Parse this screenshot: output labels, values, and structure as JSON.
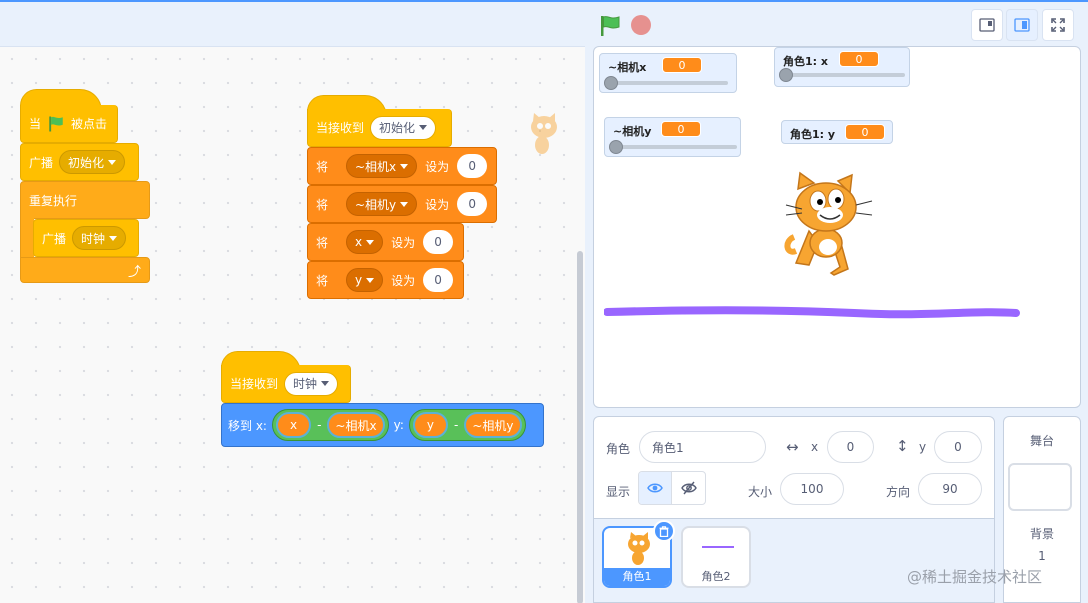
{
  "toolbar": {
    "flag_icon": "green-flag-icon",
    "stop_icon": "stop-icon"
  },
  "scripts": {
    "script1": {
      "hat_when": "当",
      "hat_clicked": "被点击",
      "broadcast": "广播",
      "broadcast_msg": "初始化",
      "forever": "重复执行",
      "broadcast2": "广播",
      "broadcast2_msg": "时钟"
    },
    "script2": {
      "hat": "当接收到",
      "hat_msg": "初始化",
      "rows": [
        {
          "set": "将",
          "var": "~相机x",
          "to": "设为",
          "value": "0"
        },
        {
          "set": "将",
          "var": "~相机y",
          "to": "设为",
          "value": "0"
        },
        {
          "set": "将",
          "var": "x",
          "to": "设为",
          "value": "0"
        },
        {
          "set": "将",
          "var": "y",
          "to": "设为",
          "value": "0"
        }
      ]
    },
    "script3": {
      "hat": "当接收到",
      "hat_msg": "时钟",
      "goto": "移到 x:",
      "x_var": "x",
      "minus": "-",
      "cam_x": "~相机x",
      "y_label": "y:",
      "y_var": "y",
      "cam_y": "~相机y"
    }
  },
  "monitors": {
    "camx": {
      "label": "~相机x",
      "value": "0"
    },
    "sprite_x": {
      "label": "角色1: x",
      "value": "0"
    },
    "camy": {
      "label": "~相机y",
      "value": "0"
    },
    "sprite_y": {
      "label": "角色1: y",
      "value": "0"
    }
  },
  "sprite_info": {
    "sprite_label": "角色",
    "sprite_name": "角色1",
    "x_label": "x",
    "x_value": "0",
    "y_label": "y",
    "y_value": "0",
    "show_label": "显示",
    "size_label": "大小",
    "size_value": "100",
    "direction_label": "方向",
    "direction_value": "90"
  },
  "sprites": [
    {
      "name": "角色1",
      "selected": true
    },
    {
      "name": "角色2",
      "selected": false
    }
  ],
  "stage_pane": {
    "title": "舞台",
    "backdrop_label": "背景",
    "backdrop_count": "1"
  },
  "watermark": "@稀土掘金技术社区",
  "colors": {
    "motion": "#4c97ff",
    "events": "#ffbf00",
    "control": "#ffab19",
    "variables": "#ff8c1a",
    "operators": "#59c059",
    "pen_line": "#9966ff"
  }
}
